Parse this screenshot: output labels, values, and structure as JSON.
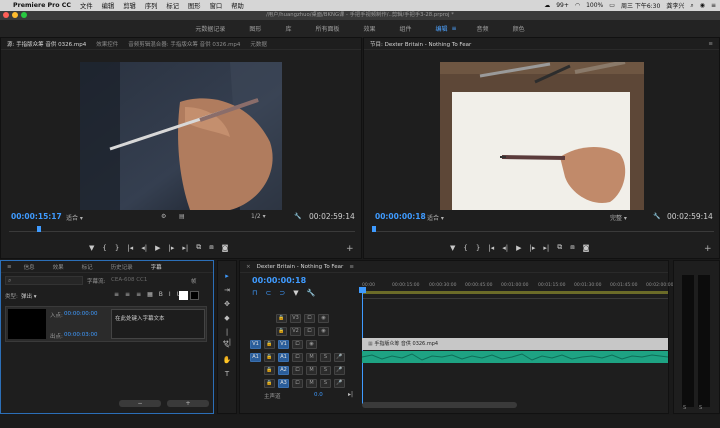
{
  "menubar": {
    "app": "Premiere Pro CC",
    "items": [
      "文件",
      "编辑",
      "剪辑",
      "序列",
      "标记",
      "图形",
      "窗口",
      "帮助"
    ],
    "status": [
      "99+",
      "100%",
      "周三 下午6:30",
      "龚李兴"
    ]
  },
  "titlebar": {
    "title": "/用户/huangzhuo/桌面/BKNG课 - 手把手视频制作/..剪辑/手把手3-28.prproj *"
  },
  "workspaces": [
    "元数据记录",
    "图形",
    "库",
    "所有面板",
    "效果",
    "组件",
    "编辑",
    "音频",
    "颜色"
  ],
  "workspaces_active": "编辑",
  "source": {
    "tabs": [
      "源: 手指版众筹 音供 0326.mp4",
      "效果控件",
      "音频剪辑混合器: 手指版众筹 音供 0326.mp4",
      "元数据"
    ],
    "timecode": "00:00:15:17",
    "fit": "适合",
    "ratio": "1/2",
    "duration": "00:02:59:14"
  },
  "program": {
    "tab": "节目: Dexter Britain - Nothing To Fear",
    "timecode": "00:00:00:18",
    "fit": "适合",
    "quality": "完整",
    "duration": "00:02:59:14"
  },
  "captions": {
    "tabs": [
      "信息",
      "效果",
      "标记",
      "历史记录",
      "字幕"
    ],
    "stream_label": "字幕流:",
    "stream_value": "CEA-608 CC1",
    "frame_label": "帧",
    "style_label": "类型:",
    "style_value": "弹出",
    "in_label": "入点:",
    "out_label": "出点:",
    "placeholder": "在此处键入字幕文本"
  },
  "timeline": {
    "tab": "Dexter Britain - Nothing To Fear",
    "timecode": "00:00:00:18",
    "ruler": [
      "00:00",
      "00:00:15:00",
      "00:00:30:00",
      "00:00:45:00",
      "00:01:00:00",
      "00:01:15:00",
      "00:01:30:00",
      "00:01:45:00",
      "00:02:00:00"
    ],
    "video_tracks": [
      "V3",
      "V2",
      "V1"
    ],
    "audio_tracks": [
      "A1",
      "A2",
      "A3"
    ],
    "master_label": "主声道",
    "master_value": "0.0",
    "clip_label": "手指版众筹 音供 0326.mp4"
  },
  "colors": {
    "accent": "#3f9bff",
    "audio_clip": "#1ea383",
    "video_clip": "#c7c7c7"
  }
}
